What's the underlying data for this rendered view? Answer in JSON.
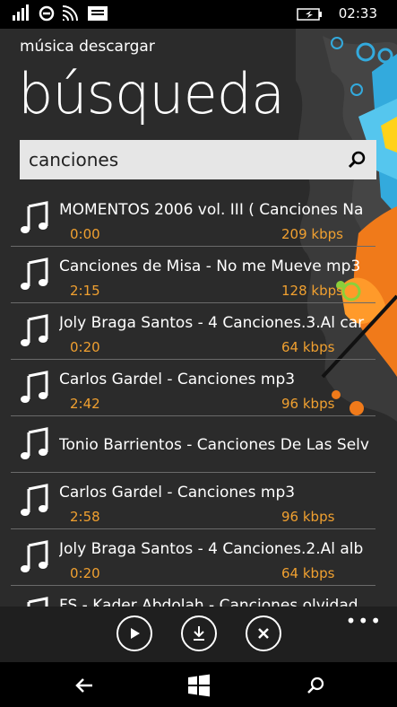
{
  "status": {
    "time": "02:33",
    "icons": [
      "signal-icon",
      "sync-icon",
      "wifi-icon",
      "message-icon",
      "battery-icon"
    ]
  },
  "app": {
    "title": "música descargar",
    "page_title": "búsqueda"
  },
  "search": {
    "value": "canciones",
    "icon": "search-icon"
  },
  "results": [
    {
      "title": "MOMENTOS 2006 vol. III ( Canciones Na",
      "duration": "0:00",
      "bitrate": "209 kbps"
    },
    {
      "title": "Canciones de Misa - No me Mueve mp3",
      "duration": "2:15",
      "bitrate": "128 kbps"
    },
    {
      "title": "Joly Braga Santos - 4 Canciones.3.Al car",
      "duration": "0:20",
      "bitrate": "64 kbps"
    },
    {
      "title": "Carlos Gardel - Canciones mp3",
      "duration": "2:42",
      "bitrate": "96 kbps"
    },
    {
      "title": "Tonio Barrientos - Canciones De Las Selv",
      "duration": "",
      "bitrate": ""
    },
    {
      "title": "Carlos Gardel - Canciones mp3",
      "duration": "2:58",
      "bitrate": "96 kbps"
    },
    {
      "title": "Joly Braga Santos - 4 Canciones.2.Al alb",
      "duration": "0:20",
      "bitrate": "64 kbps"
    },
    {
      "title": "FS - Kader Abdolah - Canciones olvidad",
      "duration": "",
      "bitrate": ""
    }
  ],
  "appbar": {
    "buttons": [
      "play-icon",
      "download-icon",
      "close-icon"
    ],
    "more": "•••"
  },
  "nav": {
    "buttons": [
      "back-icon",
      "windows-icon",
      "search-icon"
    ]
  },
  "colors": {
    "accent": "#f0a030",
    "background": "#2b2b2b",
    "appbar": "#1f1f1f"
  }
}
